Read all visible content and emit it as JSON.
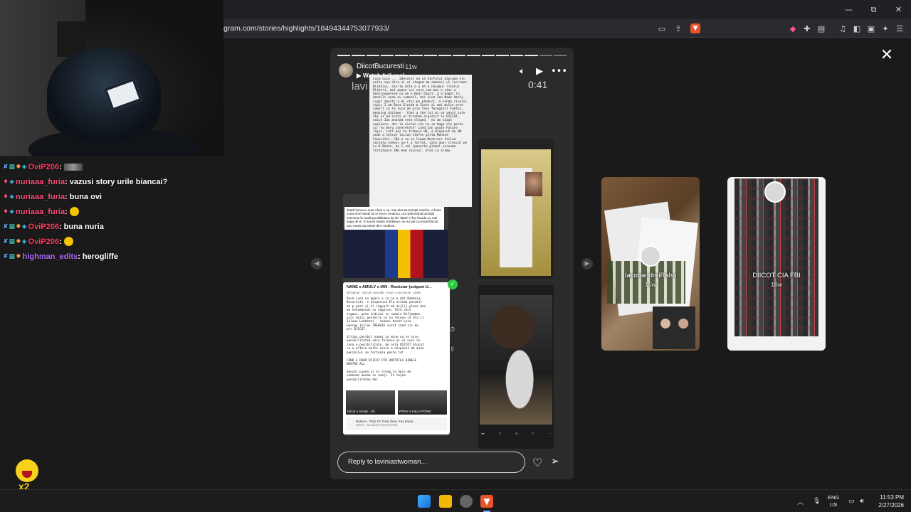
{
  "window_controls": {
    "minimize": "—",
    "maximize": "⧉",
    "close": "✕"
  },
  "address_bar": {
    "url": "gram.com/stories/highlights/18494344753077933/"
  },
  "story": {
    "username": "DiicotBucuresti",
    "age": "11w",
    "reel_label": "Watch full reel",
    "overlay_name": "lavi",
    "timer": "0:41",
    "progress_segments_done": 14,
    "progress_segments_total": 16,
    "reply_placeholder": "Reply to laviniastwoman...",
    "embedded_note": "Toată lumea e sute când e nu, mai ales Bucureşti ruscibe. A furat 3 ani ai're hainei şi ce era in America. Un rtofennimal perdjoli overview în toată penibilitatea lui de \"label\" Il fac frauda nu mai sopp de ei. E social media zombieuri, eu nu pot cu email blocat unu music sa exixte din n sobiect.",
    "embedded_doc": "Luca Luca ... adevarul eu să dinfului diploma etc oultx sau dila ni si stegem am sàmanii ul lucrimes Blibtivi, ale-le dite a a eh a nosumur ritelul Dlibtri, mai poate cui care cum mai e stoc a dealcouperesm ca ne e Beat Dauct. a a bagat la denellc unde nu cumovel, dar Luca Ian Nane Amuly sigur abuiti a mi stis pe pàndurl, a senda rivelul sipic I am Beat Glorde m Zuset al mai multe arte cumvlt ca le luca de prin tase facegieri Faktos, meaning diplome - that a the lui mi va venit sate the or ad crots al trieteh ergiotit ln DIICOT, noice Ian anatad este eleged - ei am vazut exploare, dar in niciun caz nu se bage ele peste ca \"nu merg coneretele\" cand Ian poate Future lajer, intr pos tu trebuie UK, a disparut de ON unde a televe lucian stefen gitta Moheze Favoritii. CBA e sa sa lipma Mostrars failed society nimeni nu-l a fortat, sata duer crescut pe Lu K Beatz, de I sal lpaserta global secoudo fortatoare ING mem rasciel. Vrea ja aramu.",
    "sheet": {
      "title": "NANE x AMULY x IAN - Rockstar (snippet U...",
      "meta": "@hyghan · 624 de vizionări · acum 4 ani  #mute  · altele",
      "body": "Dacă Luca nu apare e ca nu e dat România,\nBucureşti, e disparuta Ela ultima penibil\nde p past şi el răguşit mă mijlij placa doc\nde netemminat cu negoise, fete sunt\ntigani, pete indiani in numele Defjammoc\nunic muzic penibile sa nu relese ca Ala ii\nIoluan Lukbeats - nimeni decât Luca\nGeorge Iulian TREBUIE surat când zic mu\nptr DIICOT.\n\nUltimu penibil numai cu mine nu se vise\npenibilitatea care foloese şi el Luci nu\ninna o penibilitate, de asta DIICOT blocat\nca a altele multe acolo a disparut de mine\npenibilul se forteaza peste tot\n\nCÂND E DOAR DIICOT PTR UNITATEA BINELE\nNOSTRU ALL\n\nSenchi punea şi el steag la Spis de\nundeeme maaaa ce aveţi. Îs tuşea\npenibilitatea dec",
      "thumb1": "Diicot x Amuly - Sit",
      "thumb2": "PRNY x KILLA FONIC",
      "music_title": "Bulerra - Trick Or Treat (feat. Kay keyo)",
      "music_sub": "Music · Bucal & Instrumental"
    }
  },
  "previews": [
    {
      "name": "IacobandreiRaho",
      "age": "15w"
    },
    {
      "name": "DIICOT CIA FBI",
      "age": "16w"
    }
  ],
  "chat": [
    {
      "user": "OviP206",
      "color": "#ff3b5c",
      "badges": [
        "sword",
        "grid",
        "star",
        "cube"
      ],
      "message": "",
      "emote": "gray"
    },
    {
      "user": "nuriaaa_furia",
      "color": "#ff4d7d",
      "badges": [
        "heart",
        "cube"
      ],
      "message": "vazusi story urile biancai?",
      "emote": ""
    },
    {
      "user": "nuriaaa_furia",
      "color": "#ff4d7d",
      "badges": [
        "heart",
        "cube"
      ],
      "message": "buna ovi",
      "emote": ""
    },
    {
      "user": "nuriaaa_furia",
      "color": "#ff4d7d",
      "badges": [
        "heart",
        "cube"
      ],
      "message": "",
      "emote": "yellow"
    },
    {
      "user": "OviP206",
      "color": "#ff3b5c",
      "badges": [
        "sword",
        "grid",
        "star",
        "cube"
      ],
      "message": "buna nuria",
      "emote": ""
    },
    {
      "user": "OviP206",
      "color": "#ff3b5c",
      "badges": [
        "sword",
        "grid",
        "star",
        "cube"
      ],
      "message": "",
      "emote": "yellow"
    },
    {
      "user": "highman_edits",
      "color": "#b36bff",
      "badges": [
        "sword",
        "grid",
        "star"
      ],
      "message": "herogliffe",
      "emote": ""
    }
  ],
  "mascot": {
    "multiplier": "x2"
  },
  "taskbar": {
    "lang_top": "ENG",
    "lang_bottom": "US",
    "time": "11:53 PM",
    "date": "2/27/2026"
  },
  "colors": {
    "brave": "#e8542a",
    "accent_blue": "#3ab4ff",
    "check_green": "#2ecc40"
  }
}
